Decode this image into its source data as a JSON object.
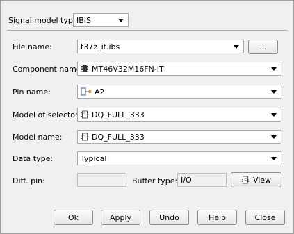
{
  "signal_model": {
    "label": "Signal model type:",
    "value": "IBIS"
  },
  "file": {
    "label": "File name:",
    "value": "t37z_it.ibs",
    "browse_label": "..."
  },
  "component": {
    "label": "Component name:",
    "value": "MT46V32M16FN-IT",
    "icon": "chip-icon"
  },
  "pin": {
    "label": "Pin name:",
    "value": "A2",
    "icon": "pin-icon"
  },
  "selector": {
    "label": "Model of selector:",
    "value": "DQ_FULL_333",
    "icon": "model-icon"
  },
  "model": {
    "label": "Model name:",
    "value": "DQ_FULL_333",
    "icon": "model-icon"
  },
  "data_type": {
    "label": "Data type:",
    "value": "Typical"
  },
  "diff_pin": {
    "label": "Diff. pin:",
    "value": ""
  },
  "buffer_type": {
    "label": "Buffer type:",
    "value": "I/O"
  },
  "view_button": {
    "label": "View",
    "icon": "model-icon"
  },
  "buttons": {
    "ok": "Ok",
    "apply": "Apply",
    "undo": "Undo",
    "help": "Help",
    "close": "Close"
  }
}
